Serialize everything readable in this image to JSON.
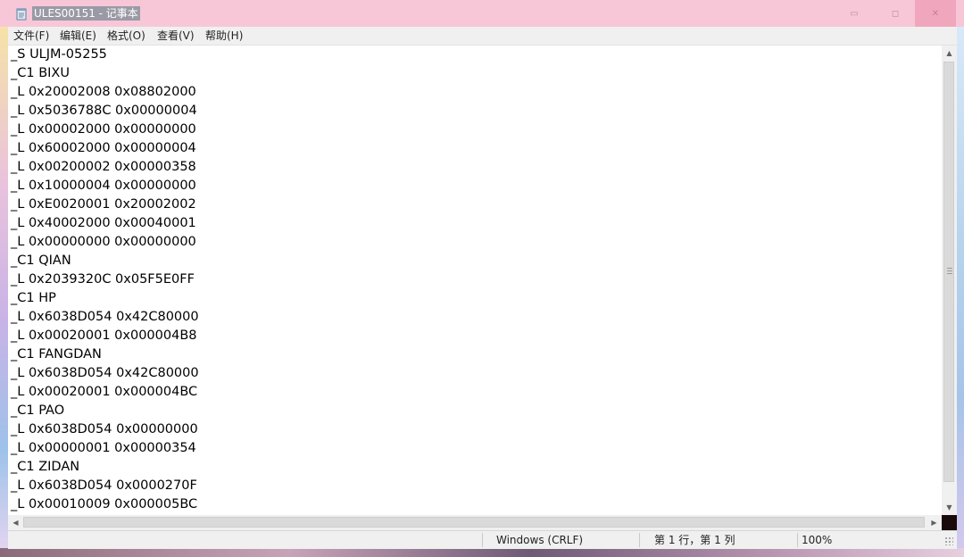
{
  "window": {
    "title": "ULES00151 - 记事本",
    "icon": "notepad-icon",
    "controls": {
      "minimize": "▭",
      "maximize": "◻",
      "close": "✕"
    }
  },
  "menu": {
    "items": [
      "文件(F)",
      "编辑(E)",
      "格式(O)",
      "查看(V)",
      "帮助(H)"
    ]
  },
  "document": {
    "lines": [
      "_S ULJM-05255",
      "_C1 BIXU",
      "_L 0x20002008 0x08802000",
      "_L 0x5036788C 0x00000004",
      "_L 0x00002000 0x00000000",
      "_L 0x60002000 0x00000004",
      "_L 0x00200002 0x00000358",
      "_L 0x10000004 0x00000000",
      "_L 0xE0020001 0x20002002",
      "_L 0x40002000 0x00040001",
      "_L 0x00000000 0x00000000",
      "_C1 QIAN",
      "_L 0x2039320C 0x05F5E0FF",
      "_C1 HP",
      "_L 0x6038D054 0x42C80000",
      "_L 0x00020001 0x000004B8",
      "_C1 FANGDAN",
      "_L 0x6038D054 0x42C80000",
      "_L 0x00020001 0x000004BC",
      "_C1 PAO",
      "_L 0x6038D054 0x00000000",
      "_L 0x00000001 0x00000354",
      "_C1 ZIDAN",
      "_L 0x6038D054 0x0000270F",
      "_L 0x00010009 0x000005BC"
    ]
  },
  "scrollbars": {
    "up_arrow": "▲",
    "down_arrow": "▼",
    "left_arrow": "◀",
    "right_arrow": "▶"
  },
  "status": {
    "encoding": "Windows (CRLF)",
    "position": "第 1 行，第 1 列",
    "zoom": "100%"
  }
}
